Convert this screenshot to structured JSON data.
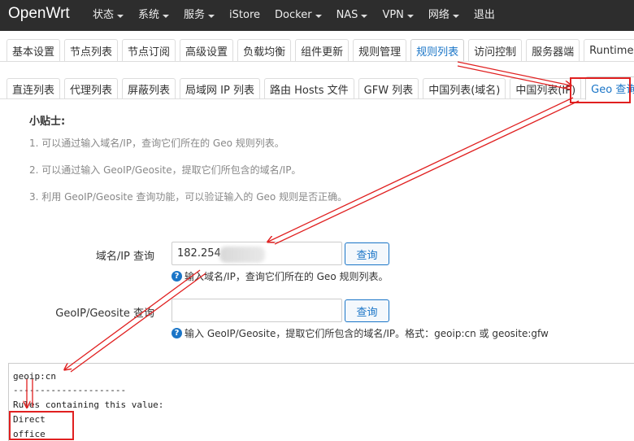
{
  "brand": "OpenWrt",
  "nav": [
    {
      "label": "状态",
      "dropdown": true
    },
    {
      "label": "系统",
      "dropdown": true
    },
    {
      "label": "服务",
      "dropdown": true
    },
    {
      "label": "iStore",
      "dropdown": false
    },
    {
      "label": "Docker",
      "dropdown": true
    },
    {
      "label": "NAS",
      "dropdown": true
    },
    {
      "label": "VPN",
      "dropdown": true
    },
    {
      "label": "网络",
      "dropdown": true
    },
    {
      "label": "退出",
      "dropdown": false
    }
  ],
  "tabs_main": [
    "基本设置",
    "节点列表",
    "节点订阅",
    "高级设置",
    "负载均衡",
    "组件更新",
    "规则管理",
    "规则列表",
    "访问控制",
    "服务器端",
    "Runtime Lo"
  ],
  "tabs_main_active": "规则列表",
  "tabs_sub": [
    "直连列表",
    "代理列表",
    "屏蔽列表",
    "局域网 IP 列表",
    "路由 Hosts 文件",
    "GFW 列表",
    "中国列表(域名)",
    "中国列表(IP)",
    "Geo 查询"
  ],
  "tabs_sub_active": "Geo 查询",
  "tips": {
    "title": "小贴士:",
    "lines": [
      "1. 可以通过输入域名/IP，查询它们所在的 Geo 规则列表。",
      "2. 可以通过输入 GeoIP/Geosite，提取它们所包含的域名/IP。",
      "3. 利用 GeoIP/Geosite 查询功能，可以验证输入的 Geo 规则是否正确。"
    ]
  },
  "form": {
    "domain_label": "域名/IP 查询",
    "domain_value": "182.254",
    "domain_button": "查询",
    "domain_help": "输入域名/IP，查询它们所在的 Geo 规则列表。",
    "geo_label": "GeoIP/Geosite 查询",
    "geo_value": "",
    "geo_button": "查询",
    "geo_help": "输入 GeoIP/Geosite，提取它们所包含的域名/IP。格式：geoip:cn 或 geosite:gfw"
  },
  "output": {
    "lines": [
      "geoip:cn",
      "---------------------",
      "Rules containing this value:",
      "Direct",
      "office"
    ]
  },
  "colors": {
    "accent": "#1a75c7",
    "annotation": "#e02020",
    "navbar": "#2d2d2d"
  }
}
